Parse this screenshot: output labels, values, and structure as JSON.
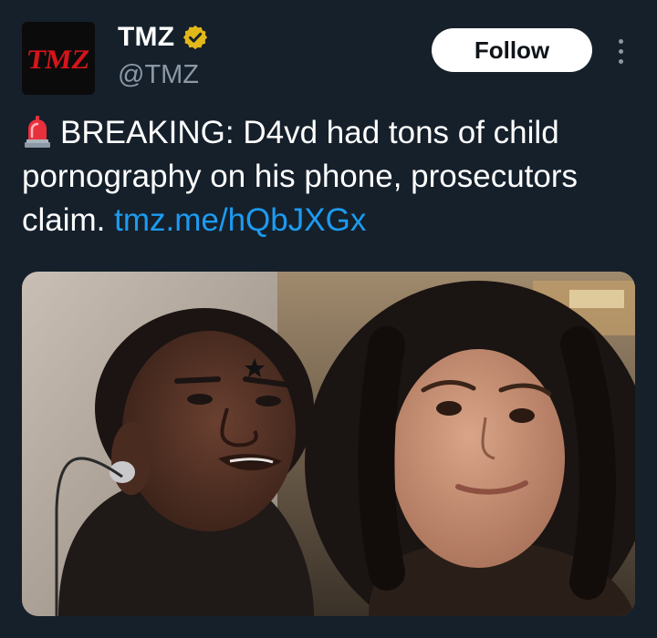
{
  "tweet": {
    "display_name": "TMZ",
    "handle": "@TMZ",
    "avatar_text": "TMZ",
    "verified_icon": "gold-verified-badge",
    "follow_label": "Follow",
    "more_icon": "vertical-ellipsis",
    "emoji": "rotating-light",
    "body_text": "BREAKING: D4vd had tons of child pornography on his phone, prosecutors claim.",
    "link_text": "tmz.me/hQbJXGx"
  },
  "colors": {
    "background": "#15202b",
    "link": "#1d9bf0",
    "secondary_text": "#8b98a5",
    "verified_gold": "#e2b719",
    "brand_red": "#d7141a"
  }
}
